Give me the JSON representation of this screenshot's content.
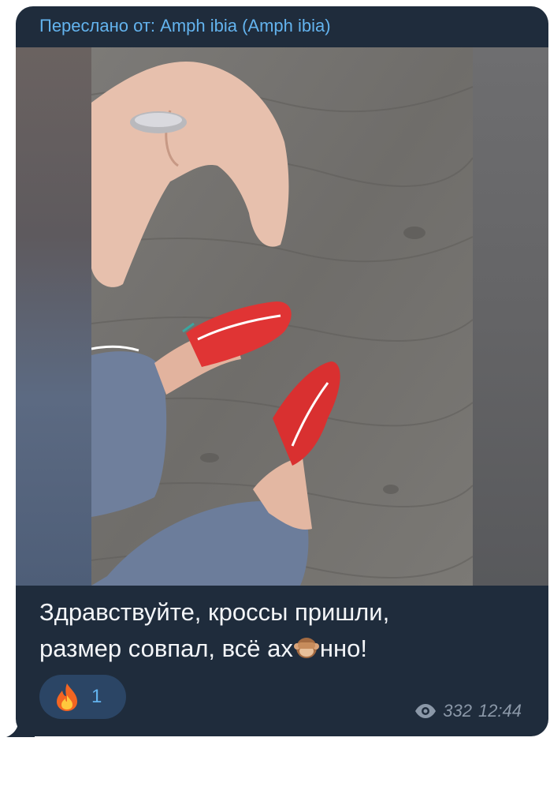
{
  "message": {
    "forwarded_label": "Переслано от: Amph ibia (Amph ibia)",
    "caption_lines": [
      "Здравствуйте, кроссы пришли,",
      "размер совпал, всё ах",
      "нно!"
    ],
    "reaction": {
      "emoji": "fire-icon",
      "count": "1"
    },
    "views": "332",
    "time": "12:44"
  },
  "colors": {
    "bubble": "#1f2c3c",
    "accent": "#63b3ee",
    "reaction_bg": "#2b4565",
    "meta": "#8b98a8"
  }
}
